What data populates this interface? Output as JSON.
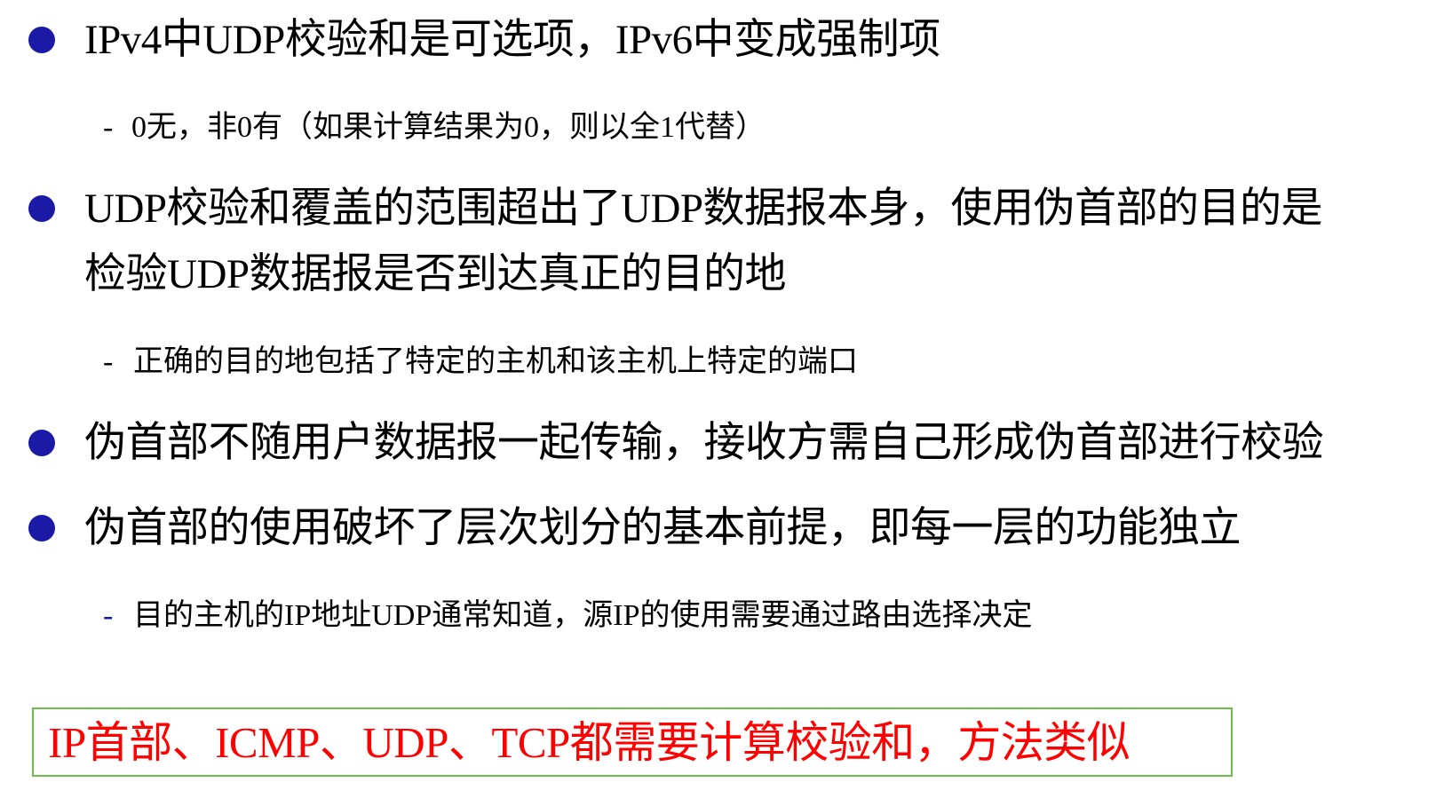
{
  "bullets": [
    {
      "text": "IPv4中UDP校验和是可选项，IPv6中变成强制项",
      "sub": "0无，非0有（如果计算结果为0，则以全1代替）"
    },
    {
      "line1": "UDP校验和覆盖的范围超出了UDP数据报本身，使用伪首部的目的是",
      "line2": "检验UDP数据报是否到达真正的目的地",
      "sub": "正确的目的地包括了特定的主机和该主机上特定的端口"
    },
    {
      "text": "伪首部不随用户数据报一起传输，接收方需自己形成伪首部进行校验"
    },
    {
      "text": "伪首部的使用破坏了层次划分的基本前提，即每一层的功能独立",
      "sub": "目的主机的IP地址UDP通常知道，源IP的使用需要通过路由选择决定"
    }
  ],
  "sub_marker": "-",
  "note": {
    "text": "IP首部、ICMP、UDP、TCP都需要计算校验和，方法类似"
  },
  "colors": {
    "bullet": "#1a1aa6",
    "note_text": "#ff0000",
    "note_border": "#6abf4b",
    "body_text": "#000000"
  }
}
